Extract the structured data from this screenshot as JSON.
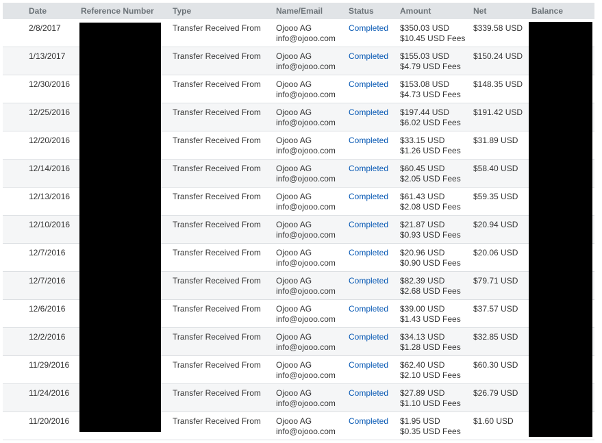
{
  "table": {
    "headers": {
      "date": "Date",
      "reference": "Reference Number",
      "type": "Type",
      "name": "Name/Email",
      "status": "Status",
      "amount": "Amount",
      "net": "Net",
      "balance": "Balance"
    },
    "rows": [
      {
        "date": "2/8/2017",
        "type": "Transfer Received From",
        "name": "Ojooo AG",
        "email": "info@ojooo.com",
        "status": "Completed",
        "amount": "$350.03 USD",
        "fees": "$10.45 USD Fees",
        "net": "$339.58 USD"
      },
      {
        "date": "1/13/2017",
        "type": "Transfer Received From",
        "name": "Ojooo AG",
        "email": "info@ojooo.com",
        "status": "Completed",
        "amount": "$155.03 USD",
        "fees": "$4.79 USD Fees",
        "net": "$150.24 USD"
      },
      {
        "date": "12/30/2016",
        "type": "Transfer Received From",
        "name": "Ojooo AG",
        "email": "info@ojooo.com",
        "status": "Completed",
        "amount": "$153.08 USD",
        "fees": "$4.73 USD Fees",
        "net": "$148.35 USD"
      },
      {
        "date": "12/25/2016",
        "type": "Transfer Received From",
        "name": "Ojooo AG",
        "email": "info@ojooo.com",
        "status": "Completed",
        "amount": "$197.44 USD",
        "fees": "$6.02 USD Fees",
        "net": "$191.42 USD"
      },
      {
        "date": "12/20/2016",
        "type": "Transfer Received From",
        "name": "Ojooo AG",
        "email": "info@ojooo.com",
        "status": "Completed",
        "amount": "$33.15 USD",
        "fees": "$1.26 USD Fees",
        "net": "$31.89 USD"
      },
      {
        "date": "12/14/2016",
        "type": "Transfer Received From",
        "name": "Ojooo AG",
        "email": "info@ojooo.com",
        "status": "Completed",
        "amount": "$60.45 USD",
        "fees": "$2.05 USD Fees",
        "net": "$58.40 USD"
      },
      {
        "date": "12/13/2016",
        "type": "Transfer Received From",
        "name": "Ojooo AG",
        "email": "info@ojooo.com",
        "status": "Completed",
        "amount": "$61.43 USD",
        "fees": "$2.08 USD Fees",
        "net": "$59.35 USD"
      },
      {
        "date": "12/10/2016",
        "type": "Transfer Received From",
        "name": "Ojooo AG",
        "email": "info@ojooo.com",
        "status": "Completed",
        "amount": "$21.87 USD",
        "fees": "$0.93 USD Fees",
        "net": "$20.94 USD"
      },
      {
        "date": "12/7/2016",
        "type": "Transfer Received From",
        "name": "Ojooo AG",
        "email": "info@ojooo.com",
        "status": "Completed",
        "amount": "$20.96 USD",
        "fees": "$0.90 USD Fees",
        "net": "$20.06 USD"
      },
      {
        "date": "12/7/2016",
        "type": "Transfer Received From",
        "name": "Ojooo AG",
        "email": "info@ojooo.com",
        "status": "Completed",
        "amount": "$82.39 USD",
        "fees": "$2.68 USD Fees",
        "net": "$79.71 USD"
      },
      {
        "date": "12/6/2016",
        "type": "Transfer Received From",
        "name": "Ojooo AG",
        "email": "info@ojooo.com",
        "status": "Completed",
        "amount": "$39.00 USD",
        "fees": "$1.43 USD Fees",
        "net": "$37.57 USD"
      },
      {
        "date": "12/2/2016",
        "type": "Transfer Received From",
        "name": "Ojooo AG",
        "email": "info@ojooo.com",
        "status": "Completed",
        "amount": "$34.13 USD",
        "fees": "$1.28 USD Fees",
        "net": "$32.85 USD"
      },
      {
        "date": "11/29/2016",
        "type": "Transfer Received From",
        "name": "Ojooo AG",
        "email": "info@ojooo.com",
        "status": "Completed",
        "amount": "$62.40 USD",
        "fees": "$2.10 USD Fees",
        "net": "$60.30 USD"
      },
      {
        "date": "11/24/2016",
        "type": "Transfer Received From",
        "name": "Ojooo AG",
        "email": "info@ojooo.com",
        "status": "Completed",
        "amount": "$27.89 USD",
        "fees": "$1.10 USD Fees",
        "net": "$26.79 USD"
      },
      {
        "date": "11/20/2016",
        "type": "Transfer Received From",
        "name": "Ojooo AG",
        "email": "info@ojooo.com",
        "status": "Completed",
        "amount": "$1.95 USD",
        "fees": "$0.35 USD Fees",
        "net": "$1.60 USD"
      }
    ]
  },
  "colors": {
    "header_bg": "#e1e4e7",
    "header_text": "#6c7378",
    "link": "#0b5bb5",
    "row_alt_bg": "#f5f6f7",
    "redaction": "#000000"
  }
}
